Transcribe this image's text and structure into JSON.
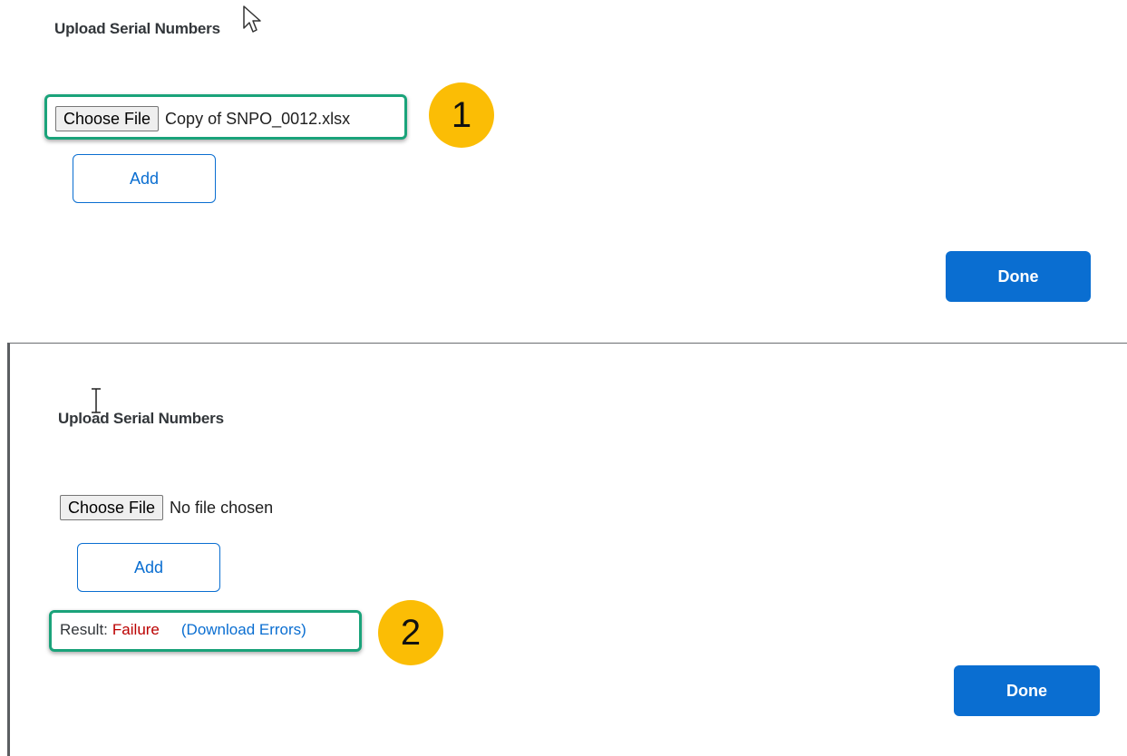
{
  "top_panel": {
    "title": "Upload Serial Numbers",
    "choose_file_label": "Choose File",
    "file_name": "Copy of SNPO_0012.xlsx",
    "add_label": "Add",
    "done_label": "Done",
    "step_number": "1"
  },
  "bottom_panel": {
    "title": "Upload Serial Numbers",
    "choose_file_label": "Choose File",
    "file_name": "No file chosen",
    "add_label": "Add",
    "result_label": "Result:",
    "result_value": "Failure",
    "download_errors_label": "(Download Errors)",
    "done_label": "Done",
    "step_number": "2"
  },
  "colors": {
    "primary": "#0a6ed1",
    "failure": "#bb0000",
    "highlight": "#1aa37a",
    "badge": "#fbbd05"
  },
  "icons": [
    "arrow-cursor-icon",
    "text-cursor-icon"
  ]
}
